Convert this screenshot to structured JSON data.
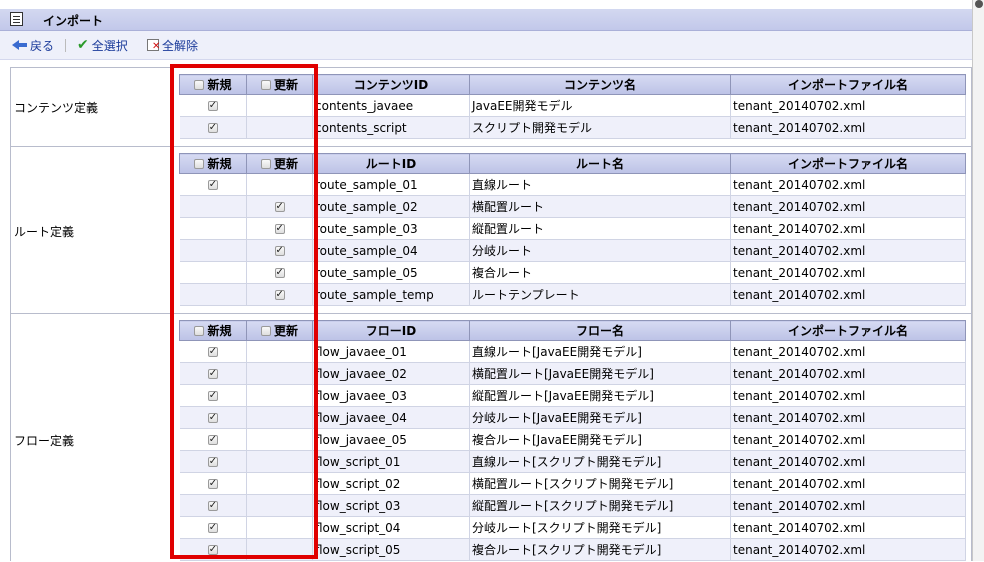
{
  "window": {
    "title": "インポート"
  },
  "toolbar": {
    "back_label": "戻る",
    "select_all_label": "全選択",
    "deselect_all_label": "全解除"
  },
  "headers": {
    "new": "新規",
    "update": "更新",
    "file": "インポートファイル名"
  },
  "sections": {
    "contents": {
      "label": "コンテンツ定義",
      "id_header": "コンテンツID",
      "name_header": "コンテンツ名",
      "rows": [
        {
          "new": true,
          "update": false,
          "id": "contents_javaee",
          "name": "JavaEE開発モデル",
          "file": "tenant_20140702.xml"
        },
        {
          "new": true,
          "update": false,
          "id": "contents_script",
          "name": "スクリプト開発モデル",
          "file": "tenant_20140702.xml"
        }
      ]
    },
    "route": {
      "label": "ルート定義",
      "id_header": "ルートID",
      "name_header": "ルート名",
      "rows": [
        {
          "new": true,
          "update": false,
          "id": "route_sample_01",
          "name": "直線ルート",
          "file": "tenant_20140702.xml"
        },
        {
          "new": false,
          "update": true,
          "id": "route_sample_02",
          "name": "横配置ルート",
          "file": "tenant_20140702.xml"
        },
        {
          "new": false,
          "update": true,
          "id": "route_sample_03",
          "name": "縦配置ルート",
          "file": "tenant_20140702.xml"
        },
        {
          "new": false,
          "update": true,
          "id": "route_sample_04",
          "name": "分岐ルート",
          "file": "tenant_20140702.xml"
        },
        {
          "new": false,
          "update": true,
          "id": "route_sample_05",
          "name": "複合ルート",
          "file": "tenant_20140702.xml"
        },
        {
          "new": false,
          "update": true,
          "id": "route_sample_temp",
          "name": "ルートテンプレート",
          "file": "tenant_20140702.xml"
        }
      ]
    },
    "flow": {
      "label": "フロー定義",
      "id_header": "フローID",
      "name_header": "フロー名",
      "rows": [
        {
          "new": true,
          "update": false,
          "id": "flow_javaee_01",
          "name": "直線ルート[JavaEE開発モデル]",
          "file": "tenant_20140702.xml"
        },
        {
          "new": true,
          "update": false,
          "id": "flow_javaee_02",
          "name": "横配置ルート[JavaEE開発モデル]",
          "file": "tenant_20140702.xml"
        },
        {
          "new": true,
          "update": false,
          "id": "flow_javaee_03",
          "name": "縦配置ルート[JavaEE開発モデル]",
          "file": "tenant_20140702.xml"
        },
        {
          "new": true,
          "update": false,
          "id": "flow_javaee_04",
          "name": "分岐ルート[JavaEE開発モデル]",
          "file": "tenant_20140702.xml"
        },
        {
          "new": true,
          "update": false,
          "id": "flow_javaee_05",
          "name": "複合ルート[JavaEE開発モデル]",
          "file": "tenant_20140702.xml"
        },
        {
          "new": true,
          "update": false,
          "id": "flow_script_01",
          "name": "直線ルート[スクリプト開発モデル]",
          "file": "tenant_20140702.xml"
        },
        {
          "new": true,
          "update": false,
          "id": "flow_script_02",
          "name": "横配置ルート[スクリプト開発モデル]",
          "file": "tenant_20140702.xml"
        },
        {
          "new": true,
          "update": false,
          "id": "flow_script_03",
          "name": "縦配置ルート[スクリプト開発モデル]",
          "file": "tenant_20140702.xml"
        },
        {
          "new": true,
          "update": false,
          "id": "flow_script_04",
          "name": "分岐ルート[スクリプト開発モデル]",
          "file": "tenant_20140702.xml"
        },
        {
          "new": true,
          "update": false,
          "id": "flow_script_05",
          "name": "複合ルート[スクリプト開発モデル]",
          "file": "tenant_20140702.xml"
        }
      ]
    }
  }
}
